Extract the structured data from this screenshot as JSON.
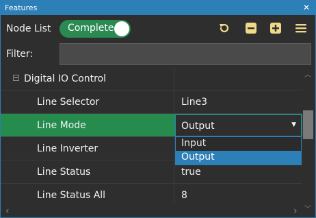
{
  "window": {
    "title": "Features",
    "close_glyph": "✕"
  },
  "toolbar": {
    "node_list_label": "Node List",
    "visibility_toggle": {
      "label": "Complete",
      "on": true
    },
    "icons": [
      "refresh-icon",
      "collapse-all-icon",
      "expand-all-icon",
      "menu-icon"
    ]
  },
  "filter": {
    "label": "Filter:",
    "value": "",
    "placeholder": ""
  },
  "tree": {
    "group": {
      "label": "Digital IO Control",
      "expanded": true
    },
    "rows": [
      {
        "name": "Line Selector",
        "value": "Line3"
      },
      {
        "name": "Line Mode",
        "value": "Output",
        "selected": true
      },
      {
        "name": "Line Inverter",
        "value": ""
      },
      {
        "name": "Line Status",
        "value": "true"
      },
      {
        "name": "Line Status All",
        "value": "8"
      }
    ]
  },
  "combo": {
    "current": "Output",
    "arrow": "▼",
    "options": [
      "Input",
      "Output"
    ],
    "highlighted": "Output"
  },
  "scroll": {
    "up": "︿",
    "down": "﹀",
    "left": "‹",
    "right": "›"
  },
  "colors": {
    "accent": "#2d7fb8",
    "selected_row": "#268c4e",
    "toggle_on": "#2a8a52",
    "toolbar_icon": "#f0d98a",
    "background": "#2e2e2e"
  }
}
